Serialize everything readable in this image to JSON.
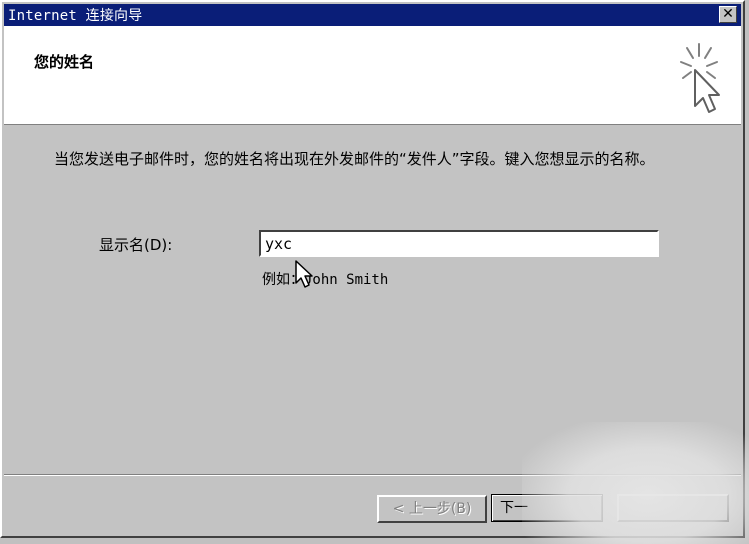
{
  "window": {
    "title": "Internet 连接向导",
    "close_symbol": "✕"
  },
  "header": {
    "heading": "您的姓名",
    "icon": "wizard-sparkle-cursor-icon"
  },
  "content": {
    "description": "当您发送电子邮件时，您的姓名将出现在外发邮件的“发件人”字段。键入您想显示的名称。",
    "display_name_label": "显示名(D):",
    "display_name_value": "yxc",
    "example_text": "例如：John Smith"
  },
  "buttons": {
    "back_label": "< 上一步(B)",
    "next_label": "下一",
    "cancel_label": ""
  },
  "colors": {
    "titlebar": "#0a1e78",
    "dialog_face": "#c3c3c3"
  }
}
